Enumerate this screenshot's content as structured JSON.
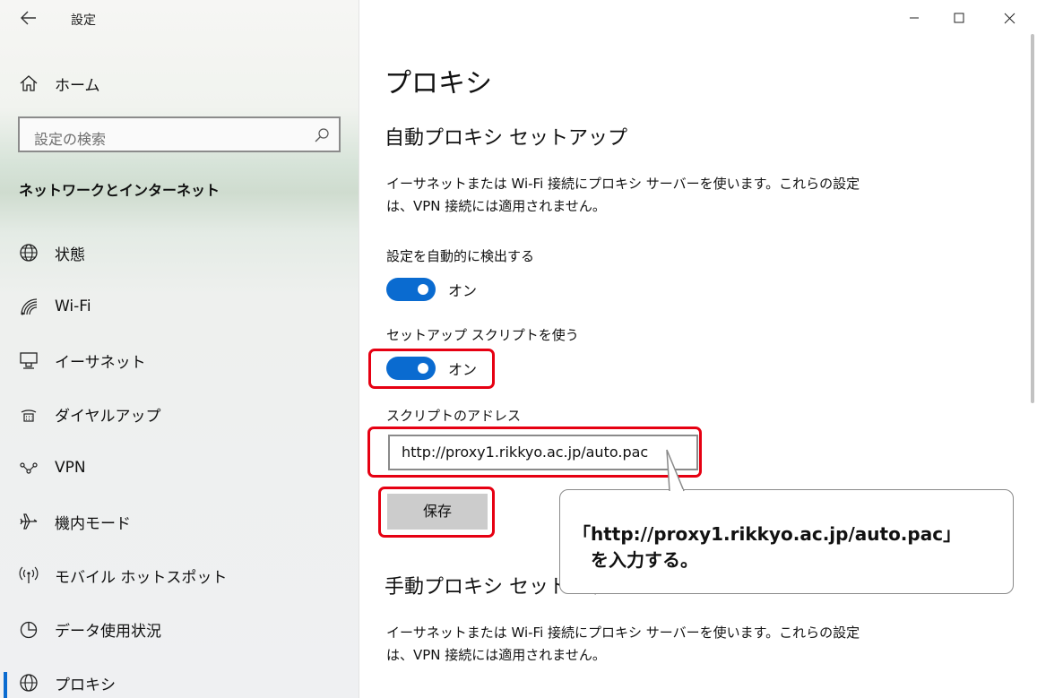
{
  "app": {
    "title": "設定"
  },
  "sidebar": {
    "home_label": "ホーム",
    "search_placeholder": "設定の検索",
    "section_title": "ネットワークとインターネット",
    "items": [
      {
        "label": "状態",
        "icon": "globe-icon"
      },
      {
        "label": "Wi-Fi",
        "icon": "wifi-icon"
      },
      {
        "label": "イーサネット",
        "icon": "ethernet-icon"
      },
      {
        "label": "ダイヤルアップ",
        "icon": "dialup-icon"
      },
      {
        "label": "VPN",
        "icon": "vpn-icon"
      },
      {
        "label": "機内モード",
        "icon": "airplane-icon"
      },
      {
        "label": "モバイル ホットスポット",
        "icon": "hotspot-icon"
      },
      {
        "label": "データ使用状況",
        "icon": "data-usage-icon"
      },
      {
        "label": "プロキシ",
        "icon": "globe-icon",
        "active": true
      }
    ]
  },
  "main": {
    "page_title": "プロキシ",
    "auto_section_title": "自動プロキシ セットアップ",
    "auto_desc_line1": "イーサネットまたは Wi-Fi 接続にプロキシ サーバーを使います。これらの設定",
    "auto_desc_line2": "は、VPN 接続には適用されません。",
    "detect_label": "設定を自動的に検出する",
    "detect_state": "オン",
    "script_label": "セットアップ スクリプトを使う",
    "script_state": "オン",
    "address_label": "スクリプトのアドレス",
    "address_value": "http://proxy1.rikkyo.ac.jp/auto.pac",
    "save_label": "保存",
    "manual_section_title": "手動プロキシ セットアップ",
    "manual_desc_line1": "イーサネットまたは Wi-Fi 接続にプロキシ サーバーを使います。これらの設定",
    "manual_desc_line2": "は、VPN 接続には適用されません。"
  },
  "callout": {
    "line1": "「http://proxy1.rikkyo.ac.jp/auto.pac」",
    "line2": "を入力する。"
  },
  "colors": {
    "accent": "#0a6bd0",
    "highlight": "#e60012",
    "button": "#cccccc"
  }
}
